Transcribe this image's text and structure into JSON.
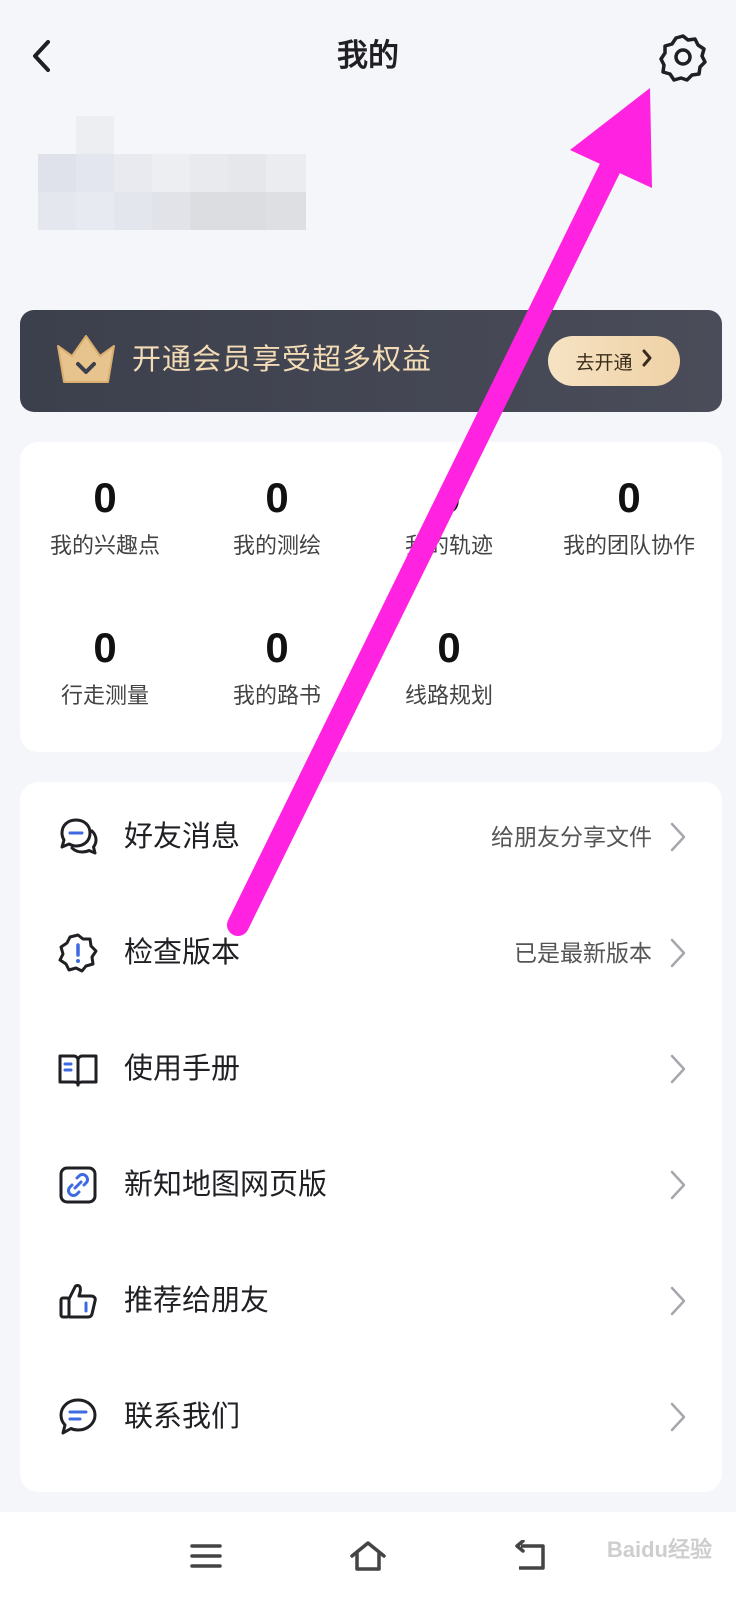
{
  "header": {
    "title": "我的",
    "back_icon": "chevron-left-icon",
    "settings_icon": "gear-icon"
  },
  "membership": {
    "text": "开通会员享受超多权益",
    "button_label": "去开通",
    "icon": "crown-icon",
    "colors": {
      "banner": "#3c3f4c",
      "text": "#f3dcb5",
      "button": "#f3dab4"
    }
  },
  "stats": [
    {
      "value": "0",
      "label": "我的兴趣点"
    },
    {
      "value": "0",
      "label": "我的测绘"
    },
    {
      "value": "0",
      "label": "我的轨迹"
    },
    {
      "value": "0",
      "label": "我的团队协作"
    },
    {
      "value": "0",
      "label": "行走测量"
    },
    {
      "value": "0",
      "label": "我的路书"
    },
    {
      "value": "0",
      "label": "线路规划"
    }
  ],
  "menu": [
    {
      "label": "好友消息",
      "subtitle": "给朋友分享文件",
      "icon": "chat-bubbles-icon"
    },
    {
      "label": "检查版本",
      "subtitle": "已是最新版本",
      "icon": "alert-badge-icon"
    },
    {
      "label": "使用手册",
      "subtitle": "",
      "icon": "book-icon"
    },
    {
      "label": "新知地图网页版",
      "subtitle": "",
      "icon": "link-icon"
    },
    {
      "label": "推荐给朋友",
      "subtitle": "",
      "icon": "thumbs-up-icon"
    },
    {
      "label": "联系我们",
      "subtitle": "",
      "icon": "message-icon"
    }
  ],
  "nav": {
    "icons": [
      "menu-icon",
      "home-icon",
      "back-icon"
    ]
  },
  "annotation": {
    "color": "#ff22e0"
  },
  "watermark": {
    "text": "Baidu经验"
  }
}
